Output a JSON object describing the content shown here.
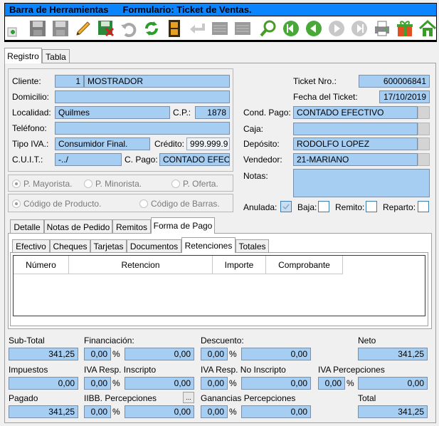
{
  "titlebar": {
    "toolbar_title": "Barra de Herramientas",
    "form_title": "Formulario: Ticket de Ventas."
  },
  "toolbar": {
    "icons": [
      "add-icon",
      "save-icon",
      "save-disabled-icon",
      "edit-icon",
      "delete-save-icon",
      "undo-icon",
      "refresh-icon",
      "film-icon",
      "back-arrow-icon",
      "list-icon",
      "list-icon-2",
      "search-icon",
      "first-icon",
      "prev-icon",
      "next-icon",
      "last-icon",
      "print-icon",
      "gift-icon",
      "home-icon"
    ]
  },
  "main_tabs": {
    "registro": "Registro",
    "tabla": "Tabla"
  },
  "client": {
    "cliente_label": "Cliente:",
    "cliente_num": "1",
    "cliente_name": "MOSTRADOR",
    "domicilio_label": "Domicilio:",
    "domicilio": "",
    "localidad_label": "Localidad:",
    "localidad": "Quilmes",
    "cp_label": "C.P.:",
    "cp": "1878",
    "telefono_label": "Teléfono:",
    "telefono": "",
    "tipo_iva_label": "Tipo IVA.:",
    "tipo_iva": "Consumidor Final.",
    "credito_label": "Crédito:",
    "credito": "999.999.9",
    "cuit_label": "C.U.I.T.:",
    "cuit": "-../",
    "cpago_label": "C. Pago:",
    "cpago": "CONTADO EFEC"
  },
  "price_options": [
    "P. Mayorista.",
    "P. Minorista.",
    "P. Oferta."
  ],
  "code_options": [
    "Código de Producto.",
    "Código de Barras."
  ],
  "ticket": {
    "nro_label": "Ticket Nro.:",
    "nro": "600006841",
    "fecha_label": "Fecha del Ticket:",
    "fecha": "17/10/2019",
    "cond_pago_label": "Cond. Pago:",
    "cond_pago": "CONTADO EFECTIVO",
    "caja_label": "Caja:",
    "caja": "",
    "deposito_label": "Depósito:",
    "deposito": "RODOLFO LOPEZ",
    "vendedor_label": "Vendedor:",
    "vendedor": "21-MARIANO",
    "notas_label": "Notas:",
    "notas": "",
    "anulada_label": "Anulada:",
    "baja_label": "Baja:",
    "remito_label": "Remito:",
    "reparto_label": "Reparto:"
  },
  "detail_tabs": [
    "Detalle",
    "Notas de Pedido",
    "Remitos",
    "Forma de Pago"
  ],
  "payment_tabs": [
    "Efectivo",
    "Cheques",
    "Tarjetas",
    "Documentos",
    "Retenciones",
    "Totales"
  ],
  "grid_columns": [
    "Número",
    "Retencion",
    "Importe",
    "Comprobante"
  ],
  "totals": {
    "subtotal_label": "Sub-Total",
    "subtotal": "341,25",
    "financiacion_label": "Financiación:",
    "fin_pct": "0,00",
    "fin_val": "0,00",
    "descuento_label": "Descuento:",
    "desc_pct": "0,00",
    "desc_val": "0,00",
    "neto_label": "Neto",
    "neto": "341,25",
    "impuestos_label": "Impuestos",
    "impuestos": "0,00",
    "iva_ri_label": "IVA Resp. Inscripto",
    "iva_ri_pct": "0,00",
    "iva_ri_val": "0,00",
    "iva_rni_label": "IVA Resp. No Inscripto",
    "iva_rni_pct": "0,00",
    "iva_rni_val": "0,00",
    "iva_perc_label": "IVA Percepciones",
    "iva_perc_pct": "0,00",
    "iva_perc_val": "0,00",
    "pagado_label": "Pagado",
    "pagado": "341,25",
    "iibb_label": "IIBB. Percepciones",
    "iibb_pct": "0,00",
    "iibb_val": "0,00",
    "iibb_btn": "...",
    "ganancias_label": "Ganancias Percepciones",
    "gan_pct": "0,00",
    "gan_val": "0,00",
    "total_label": "Total",
    "total": "341,25",
    "percent_sign": "%"
  }
}
